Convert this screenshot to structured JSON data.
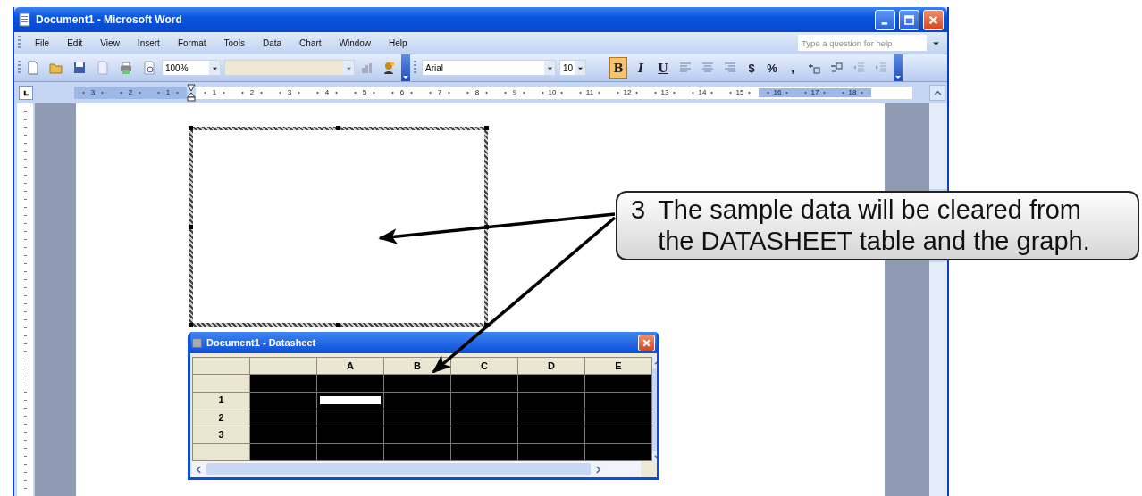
{
  "window": {
    "title": "Document1 - Microsoft Word"
  },
  "menu_bar": {
    "items": [
      "File",
      "Edit",
      "View",
      "Insert",
      "Format",
      "Tools",
      "Data",
      "Chart",
      "Window",
      "Help"
    ],
    "help_box": {
      "placeholder": "Type a question for help"
    }
  },
  "standard_toolbar": {
    "zoom": "100%"
  },
  "formatting_toolbar": {
    "font": "Arial",
    "size": "10",
    "buttons": [
      {
        "kind": "bold",
        "label": "B",
        "selected": true
      },
      {
        "kind": "italic",
        "label": "I",
        "selected": false
      },
      {
        "kind": "underline",
        "label": "U",
        "selected": false
      },
      {
        "kind": "align-left",
        "selected": false
      },
      {
        "kind": "align-center",
        "selected": false
      },
      {
        "kind": "align-right",
        "selected": false
      },
      {
        "kind": "text",
        "label": "$",
        "selected": false
      },
      {
        "kind": "text",
        "label": "%",
        "selected": false
      },
      {
        "kind": "text",
        "label": ",",
        "selected": false
      },
      {
        "kind": "increase-decimal",
        "selected": false
      },
      {
        "kind": "decrease-decimal",
        "selected": false
      },
      {
        "kind": "outdent",
        "selected": false
      },
      {
        "kind": "indent",
        "selected": false
      }
    ]
  },
  "ruler": {
    "left_labels": [
      "3",
      "2",
      "1"
    ],
    "right_labels": [
      "1",
      "2",
      "3",
      "4",
      "5",
      "6",
      "7",
      "8",
      "9",
      "10",
      "11",
      "12",
      "13",
      "14",
      "15",
      "16",
      "17",
      "18"
    ]
  },
  "datasheet": {
    "title": "Document1 - Datasheet",
    "columns": [
      "A",
      "B",
      "C",
      "D",
      "E"
    ],
    "rows": [
      {
        "cells": [
          {
            "selected": true,
            "active": false
          },
          {
            "selected": true,
            "active": false
          },
          {
            "selected": true,
            "active": false
          },
          {
            "selected": true,
            "active": false
          },
          {
            "selected": true,
            "active": false
          },
          {
            "selected": true,
            "active": false
          }
        ]
      },
      {
        "label": "1",
        "cells": [
          {
            "selected": true,
            "active": false
          },
          {
            "selected": true,
            "active": true
          },
          {
            "selected": true,
            "active": false
          },
          {
            "selected": true,
            "active": false
          },
          {
            "selected": true,
            "active": false
          },
          {
            "selected": true,
            "active": false
          }
        ]
      },
      {
        "label": "2",
        "cells": [
          {
            "selected": true,
            "active": false
          },
          {
            "selected": true,
            "active": false
          },
          {
            "selected": true,
            "active": false
          },
          {
            "selected": true,
            "active": false
          },
          {
            "selected": true,
            "active": false
          },
          {
            "selected": true,
            "active": false
          }
        ]
      },
      {
        "label": "3",
        "cells": [
          {
            "selected": true,
            "active": false
          },
          {
            "selected": true,
            "active": false
          },
          {
            "selected": true,
            "active": false
          },
          {
            "selected": true,
            "active": false
          },
          {
            "selected": true,
            "active": false
          },
          {
            "selected": true,
            "active": false
          }
        ]
      },
      {
        "cells": [
          {
            "selected": true,
            "active": false
          },
          {
            "selected": true,
            "active": false
          },
          {
            "selected": true,
            "active": false
          },
          {
            "selected": true,
            "active": false
          },
          {
            "selected": true,
            "active": false
          },
          {
            "selected": true,
            "active": false
          }
        ]
      }
    ]
  },
  "callout": {
    "step": "3",
    "text": "The sample data will be cleared from the DATASHEET table and the graph."
  }
}
